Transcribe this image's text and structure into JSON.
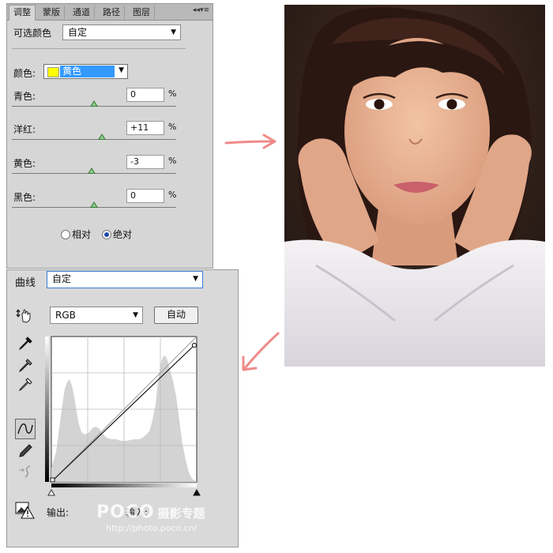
{
  "adjust_panel": {
    "tabs": [
      "调整",
      "蒙版",
      "通道",
      "路径",
      "图层"
    ],
    "title": "可选颜色",
    "preset_value": "自定",
    "color_label": "颜色:",
    "color_value": "黄色",
    "color_swatch": "#ffff00",
    "sliders": [
      {
        "label": "青色:",
        "value": "0",
        "unit": "%",
        "level": 0.5
      },
      {
        "label": "洋红:",
        "value": "+11",
        "unit": "%",
        "level": 0.55
      },
      {
        "label": "黄色:",
        "value": "-3",
        "unit": "%",
        "level": 0.485
      },
      {
        "label": "黑色:",
        "value": "0",
        "unit": "%",
        "level": 0.5
      }
    ],
    "mode_relative": "相对",
    "mode_absolute": "绝对",
    "mode_selected": "绝对"
  },
  "curves_panel": {
    "title": "曲线",
    "preset_value": "自定",
    "channel_value": "RGB",
    "auto_button": "自动",
    "output_label": "输出:",
    "input_label": "输入:"
  },
  "watermark": {
    "brand": "POCO",
    "subtitle": "摄影专题",
    "url": "http://photo.poco.cn/"
  },
  "colors": {
    "arrow": "#f08a8a",
    "accent_blue": "#3399ff",
    "slider_thumb": "#3e7a3e"
  },
  "icons": [
    "hand-adjust-icon",
    "eyedropper-black-icon",
    "eyedropper-gray-icon",
    "eyedropper-white-icon",
    "curve-tool-icon",
    "pencil-icon",
    "smooth-curve-icon",
    "clipping-warning-icon",
    "panel-menu-icon",
    "chevron-down-icon",
    "arrow-right-icon",
    "arrow-down-left-icon"
  ]
}
